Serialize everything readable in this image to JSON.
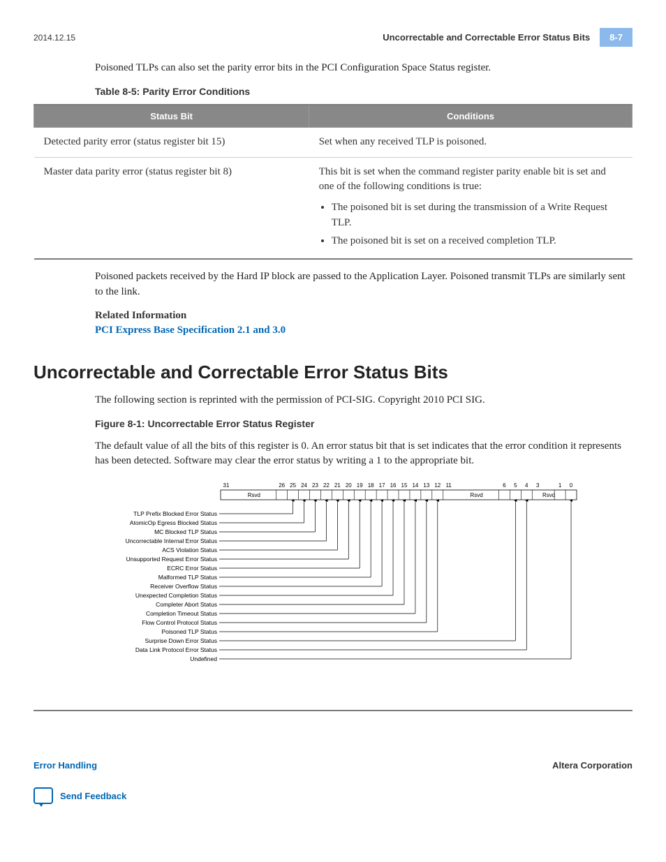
{
  "meta": {
    "date": "2014.12.15",
    "header_title": "Uncorrectable and Correctable Error Status Bits",
    "page_num": "8-7"
  },
  "body": {
    "para1": "Poisoned TLPs can also set the parity error bits in the PCI Configuration Space Status register.",
    "table_title": "Table 8-5: Parity Error Conditions",
    "table": {
      "head": {
        "c1": "Status Bit",
        "c2": "Conditions"
      },
      "r1": {
        "c1": "Detected parity error (status register bit 15)",
        "c2": "Set when any received TLP is poisoned."
      },
      "r2": {
        "c1": "Master data parity error (status register bit 8)",
        "intro": "This bit is set when the command register parity enable bit is set and one of the following conditions is true:",
        "li1": "The poisoned bit is set during the transmission of a Write Request TLP.",
        "li2": "The poisoned bit is set on a received completion TLP."
      }
    },
    "para2": "Poisoned packets received by the Hard IP block are passed to the Application Layer. Poisoned transmit TLPs are similarly sent to the link.",
    "related_heading": "Related Information",
    "related_link": "PCI Express Base Specification 2.1 and 3.0",
    "section_heading": "Uncorrectable and Correctable Error Status Bits",
    "para3": "The following section is reprinted with the permission of PCI-SIG. Copyright 2010 PCI SIG.",
    "figure_title": "Figure 8-1: Uncorrectable Error Status Register",
    "para4": "The default value of all the bits of this register is 0. An error status bit that is set indicates that the error condition it represents has been detected. Software may clear the error status by writing a 1 to the appropriate bit."
  },
  "figure": {
    "bit_numbers": [
      "31",
      "26",
      "25",
      "24",
      "23",
      "22",
      "21",
      "20",
      "19",
      "18",
      "17",
      "16",
      "15",
      "14",
      "13",
      "12",
      "11",
      "6",
      "5",
      "4",
      "3",
      "1",
      "0"
    ],
    "boxes": {
      "rsvd1": "Rsvd",
      "rsvd2": "Rsvd",
      "rsvd3": "Rsvd"
    },
    "labels": [
      "TLP Prefix Blocked Error Status",
      "AtomicOp Egress Blocked Status",
      "MC Blocked TLP Status",
      "Uncorrectable Internal Error Status",
      "ACS Violation Status",
      "Unsupported Request Error Status",
      "ECRC Error Status",
      "Malformed TLP Status",
      "Receiver Overflow Status",
      "Unexpected Completion Status",
      "Completer Abort Status",
      "Completion Timeout Status",
      "Flow Control Protocol Status",
      "Poisoned TLP Status",
      "Surprise Down Error Status",
      "Data Link Protocol Error Status",
      "Undefined"
    ]
  },
  "footer": {
    "left": "Error Handling",
    "right": "Altera Corporation",
    "feedback": "Send Feedback"
  }
}
